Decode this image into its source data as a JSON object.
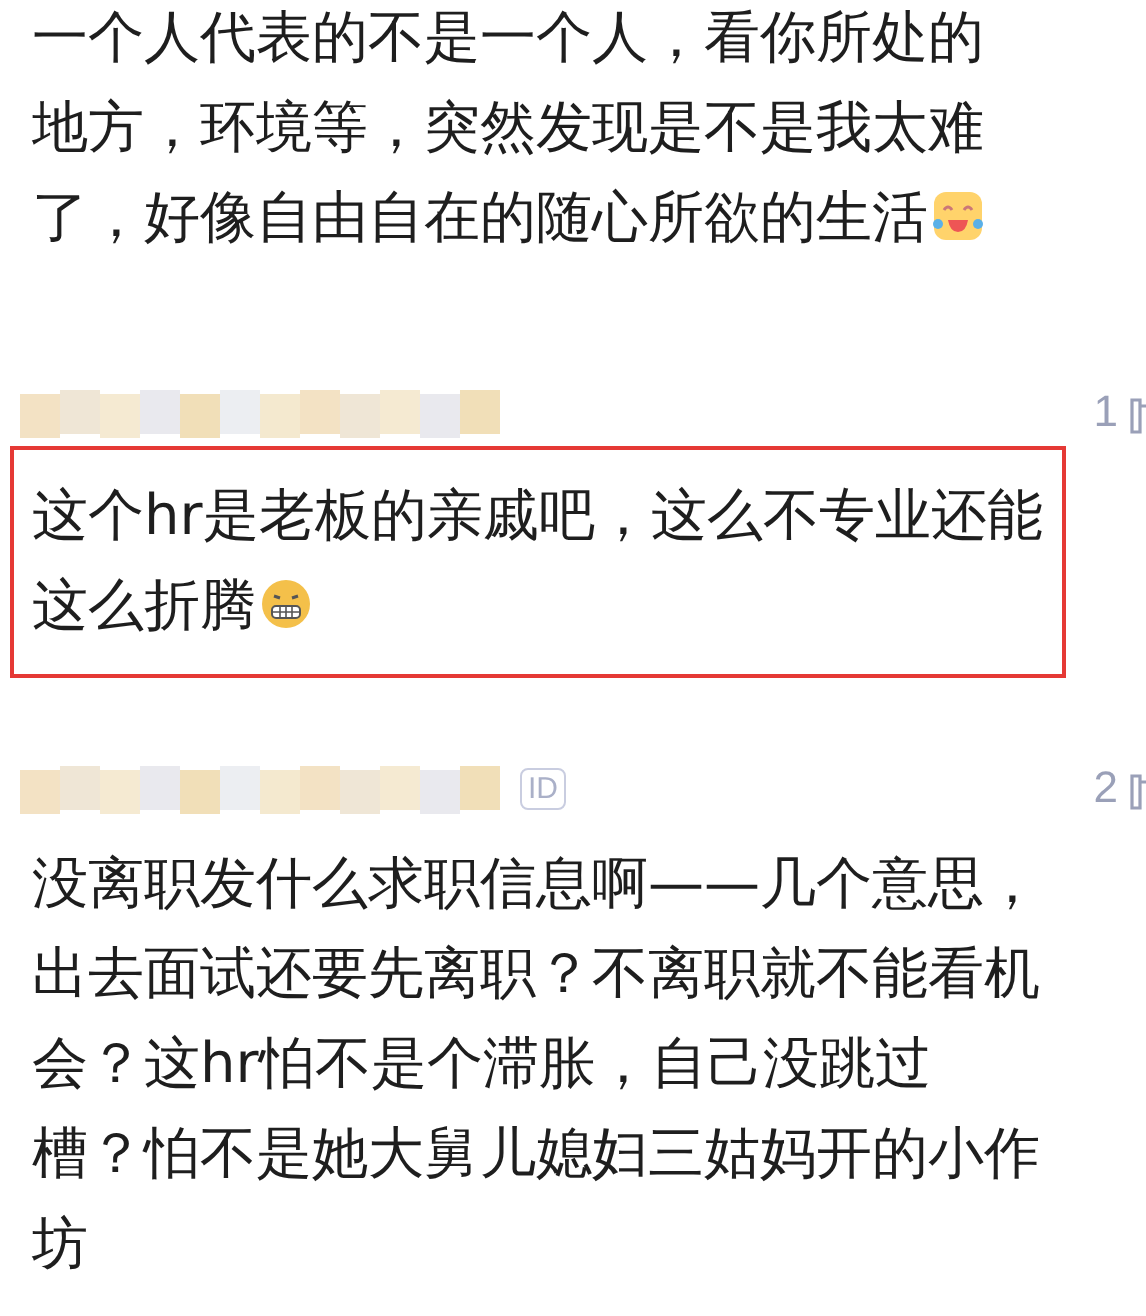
{
  "comments": [
    {
      "highlighted": false,
      "text": "一个人代表的不是一个人，看你所处的地方，环境等，突然发现是不是我太难了，好像自由自在的随心所欲的生活",
      "emoji": {
        "kind": "tears"
      }
    },
    {
      "likes": "1",
      "highlighted": true,
      "text": "这个hr是老板的亲戚吧，这么不专业还能这么折腾",
      "emoji": {
        "kind": "grimace"
      }
    },
    {
      "badge": "ID",
      "likes": "2",
      "highlighted": false,
      "text": "没离职发什么求职信息啊——几个意思，出去面试还要先离职？不离职就不能看机会？这hr怕不是个滞胀，自己没跳过槽？怕不是她大舅儿媳妇三姑妈开的小作坊"
    }
  ]
}
